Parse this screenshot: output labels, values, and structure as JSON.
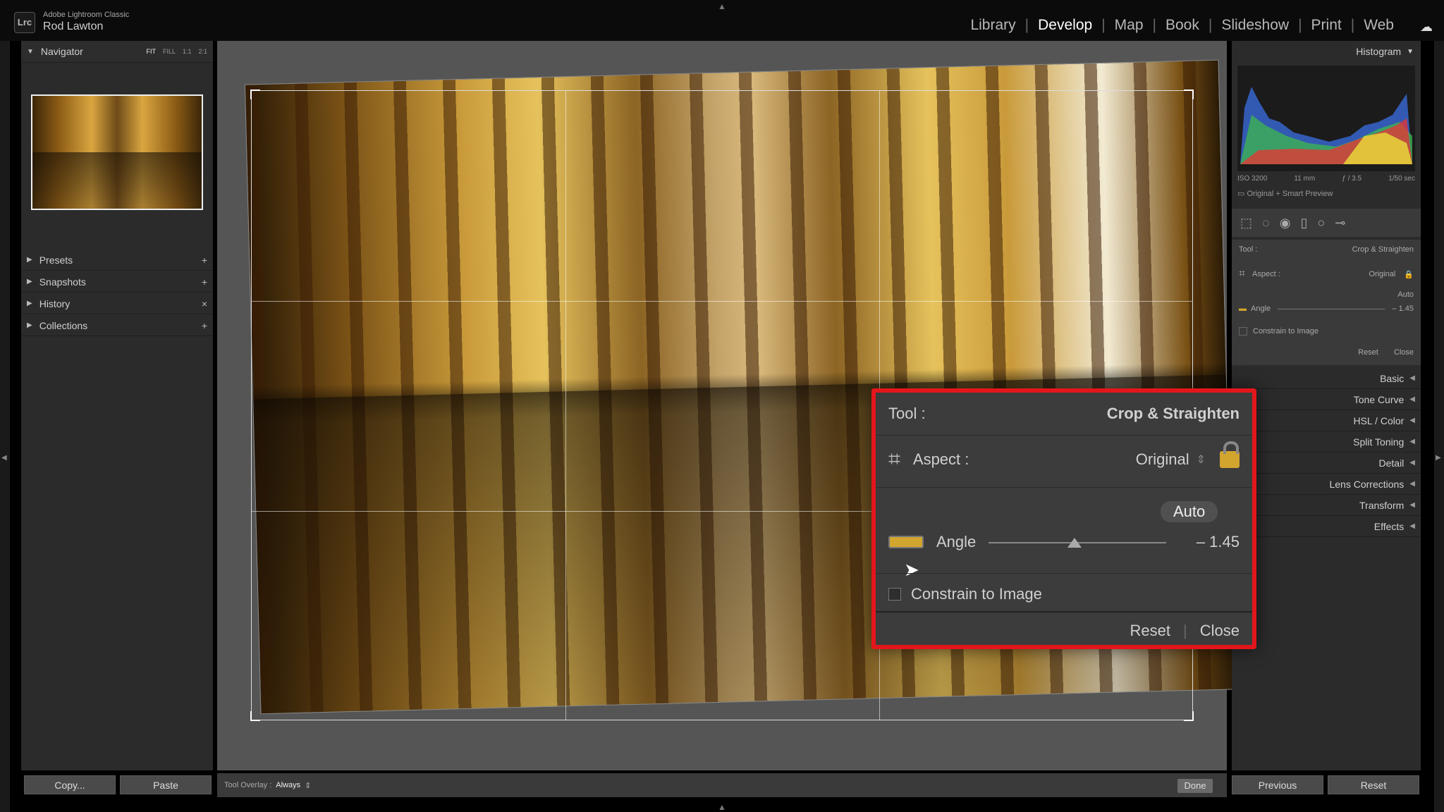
{
  "app": {
    "name": "Adobe Lightroom Classic",
    "user": "Rod Lawton",
    "logo": "Lrc"
  },
  "modules": [
    {
      "label": "Library",
      "active": false
    },
    {
      "label": "Develop",
      "active": true
    },
    {
      "label": "Map",
      "active": false
    },
    {
      "label": "Book",
      "active": false
    },
    {
      "label": "Slideshow",
      "active": false
    },
    {
      "label": "Print",
      "active": false
    },
    {
      "label": "Web",
      "active": false
    }
  ],
  "left": {
    "navigator": {
      "title": "Navigator",
      "zoom": [
        "FIT",
        "FILL",
        "1:1",
        "2:1"
      ],
      "active_zoom": "FIT"
    },
    "panels": [
      {
        "label": "Presets",
        "action": "+"
      },
      {
        "label": "Snapshots",
        "action": "+"
      },
      {
        "label": "History",
        "action": "×"
      },
      {
        "label": "Collections",
        "action": "+"
      }
    ],
    "copy_label": "Copy...",
    "paste_label": "Paste"
  },
  "toolbar": {
    "overlay_label": "Tool Overlay :",
    "overlay_value": "Always",
    "done_label": "Done"
  },
  "right": {
    "histogram_title": "Histogram",
    "meta": {
      "iso": "ISO 3200",
      "focal": "11 mm",
      "aperture": "ƒ / 3.5",
      "shutter": "1/50 sec"
    },
    "preview_label": "Original + Smart Preview",
    "crop": {
      "tool_label": "Tool :",
      "tool_name": "Crop & Straighten",
      "aspect_label": "Aspect :",
      "aspect_value": "Original",
      "auto_label": "Auto",
      "angle_label": "Angle",
      "angle_value": "– 1.45",
      "angle": -1.45,
      "constrain_label": "Constrain to Image",
      "reset_label": "Reset",
      "close_label": "Close"
    },
    "panels": [
      {
        "label": "Basic"
      },
      {
        "label": "Tone Curve"
      },
      {
        "label": "HSL / Color"
      },
      {
        "label": "Split Toning"
      },
      {
        "label": "Detail"
      },
      {
        "label": "Lens Corrections"
      },
      {
        "label": "Transform"
      },
      {
        "label": "Effects"
      }
    ],
    "previous_label": "Previous",
    "reset_label": "Reset"
  },
  "accent": "#e3161b"
}
